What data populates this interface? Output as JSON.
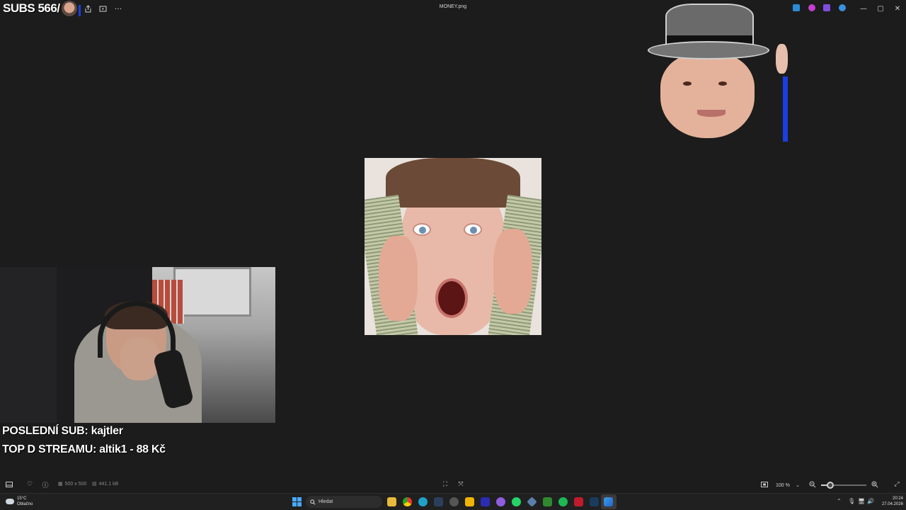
{
  "window": {
    "title": "MONEY.png",
    "controls": {
      "minimize": "—",
      "maximize": "▢",
      "close": "✕"
    }
  },
  "toolbar": {
    "icons": [
      "share-icon",
      "slideshow-icon",
      "more-icon"
    ],
    "more_label": "···"
  },
  "stream_overlay": {
    "subs_counter": "SUBS 566/",
    "last_sub": "POSLEDNÍ SUB: kajtler",
    "top_donation": "TOP D STREAMU: altik1 - 88 Kč"
  },
  "statusbar": {
    "dimensions": "500 x 500",
    "file_size": "441,1 kB",
    "zoom": "100 %",
    "zoom_level": 0.2
  },
  "taskbar": {
    "weather": {
      "temp": "15°C",
      "condition": "Oblačno"
    },
    "search_placeholder": "Hledat",
    "clock": {
      "time": "20:24",
      "date": "27.04.2026"
    }
  },
  "colors": {
    "background": "#1c1c1c",
    "overlay_accent": "#1a3fe0",
    "start_accent": "#4aa8ff"
  }
}
